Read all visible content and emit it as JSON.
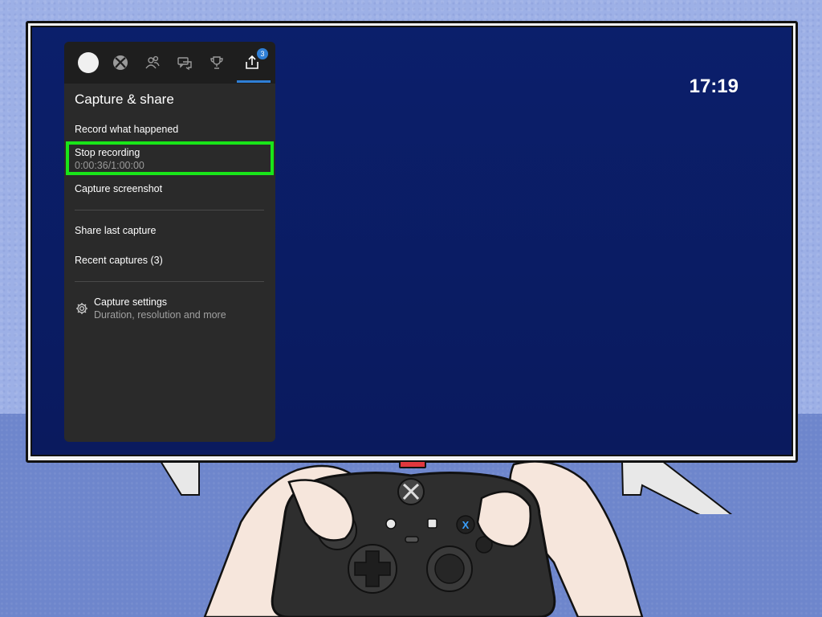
{
  "screen": {
    "clock": "17:19"
  },
  "guide": {
    "tabs": [
      {
        "icon": "profile-avatar"
      },
      {
        "icon": "xbox-logo-icon"
      },
      {
        "icon": "people-icon"
      },
      {
        "icon": "chat-icon"
      },
      {
        "icon": "trophy-icon"
      },
      {
        "icon": "share-icon",
        "badge": "3",
        "selected": true
      }
    ],
    "title": "Capture & share",
    "items": {
      "record_what_happened": "Record what happened",
      "stop_recording": "Stop recording",
      "recording_time": "0:00:36/1:00:00",
      "capture_screenshot": "Capture screenshot",
      "share_last_capture": "Share last capture",
      "recent_captures": "Recent captures (3)",
      "capture_settings": "Capture settings",
      "capture_settings_sub": "Duration, resolution and more"
    }
  },
  "controller": {
    "x_button": "X"
  },
  "colors": {
    "focus": "#19e619",
    "accent": "#2f7fd6",
    "screen": "#0b1f6b",
    "panel": "#2a2a2a"
  }
}
